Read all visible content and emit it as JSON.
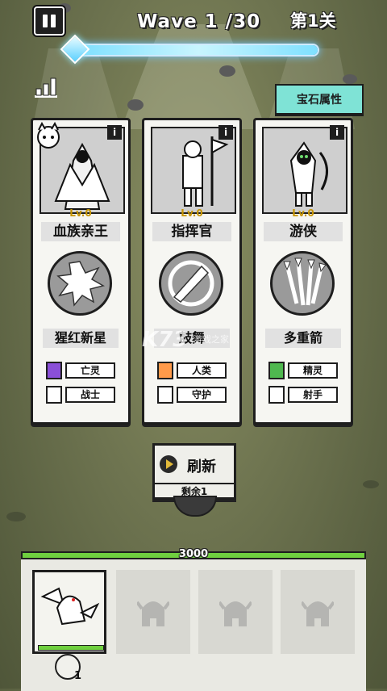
{
  "hud": {
    "wave_label": "Wave 1 /30",
    "stage_label": "第1关",
    "wave_progress": 1.0,
    "gem_attr_label": "宝石属性"
  },
  "cards": [
    {
      "info": "i",
      "level": "Lv.0",
      "name": "血族亲王",
      "skill": "猩红新星",
      "tags": [
        {
          "label": "亡灵",
          "icon": "undead-icon",
          "color": "#8a4fd8"
        },
        {
          "label": "战士",
          "icon": "warrior-icon",
          "color": "#ffffff"
        }
      ]
    },
    {
      "info": "i",
      "level": "Lv.0",
      "name": "指挥官",
      "skill": "鼓舞",
      "tags": [
        {
          "label": "人类",
          "icon": "human-icon",
          "color": "#ff9a4a"
        },
        {
          "label": "守护",
          "icon": "guardian-icon",
          "color": "#ffffff"
        }
      ]
    },
    {
      "info": "i",
      "level": "Lv.0",
      "name": "游侠",
      "skill": "多重箭",
      "tags": [
        {
          "label": "精灵",
          "icon": "elf-icon",
          "color": "#4fb84f"
        },
        {
          "label": "射手",
          "icon": "archer-icon",
          "color": "#ffffff"
        }
      ]
    }
  ],
  "refresh": {
    "label": "刷新",
    "remaining": "剩余1"
  },
  "base": {
    "hp": "3000"
  },
  "bench": {
    "unit_count": "1"
  },
  "watermark": {
    "main": "K73",
    "sub": "游戏之家"
  },
  "colors": {
    "accent_teal": "#7fe3d6",
    "hp_green": "#6fcf3f",
    "level_gold": "#c69400",
    "wave_cyan": "#7fe0ff"
  }
}
